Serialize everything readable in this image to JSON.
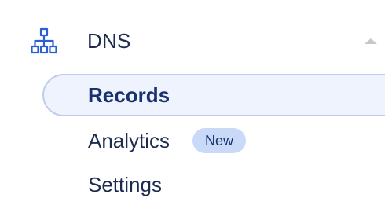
{
  "dns_section": {
    "label": "DNS",
    "icon": "sitemap-icon",
    "collapse_icon": "chevron-up-icon",
    "expanded": true,
    "items": [
      {
        "label": "Records",
        "active": true
      },
      {
        "label": "Analytics",
        "badge": "New"
      },
      {
        "label": "Settings"
      }
    ]
  },
  "colors": {
    "text": "#1c2b4e",
    "active_text": "#1a3170",
    "icon": "#2a5fd6",
    "active_bg": "#eef3fd",
    "active_border": "#bccdf0",
    "badge_bg": "#c9daf8",
    "chevron": "#c3c7ce"
  }
}
